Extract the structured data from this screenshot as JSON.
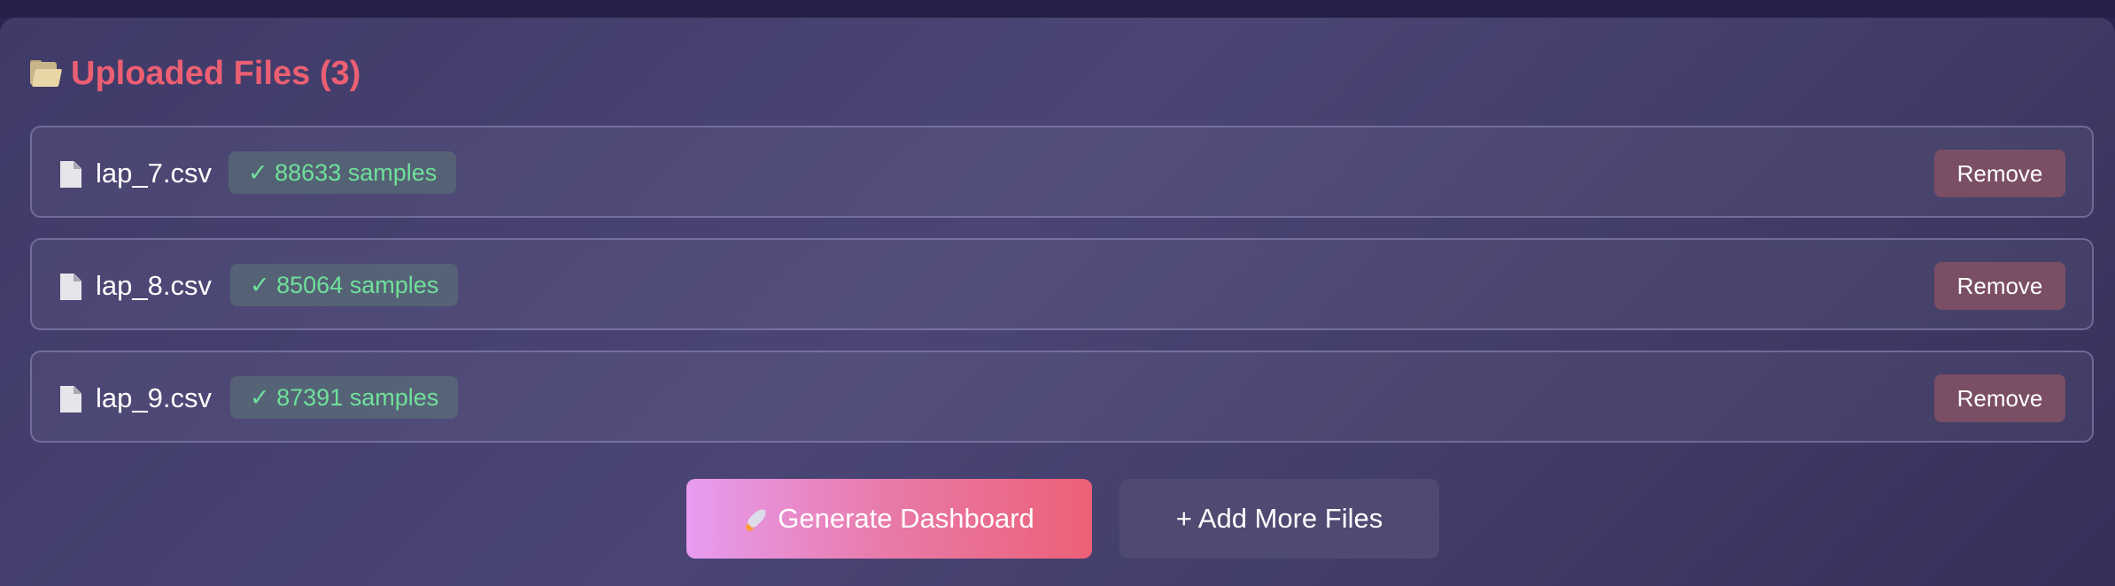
{
  "header": {
    "icon": "open-folder-icon",
    "title": "Uploaded Files (3)",
    "accent_color": "#ec5f72"
  },
  "files": [
    {
      "name": "lap_7.csv",
      "status": "✓ 88633 samples",
      "remove_label": "Remove"
    },
    {
      "name": "lap_8.csv",
      "status": "✓ 85064 samples",
      "remove_label": "Remove"
    },
    {
      "name": "lap_9.csv",
      "status": "✓ 87391 samples",
      "remove_label": "Remove"
    }
  ],
  "actions": {
    "generate_label": "Generate Dashboard",
    "generate_icon": "rocket-icon",
    "add_label": "+ Add More Files"
  },
  "colors": {
    "status_text": "#6fe09a",
    "remove_button": "#7a4e64"
  }
}
